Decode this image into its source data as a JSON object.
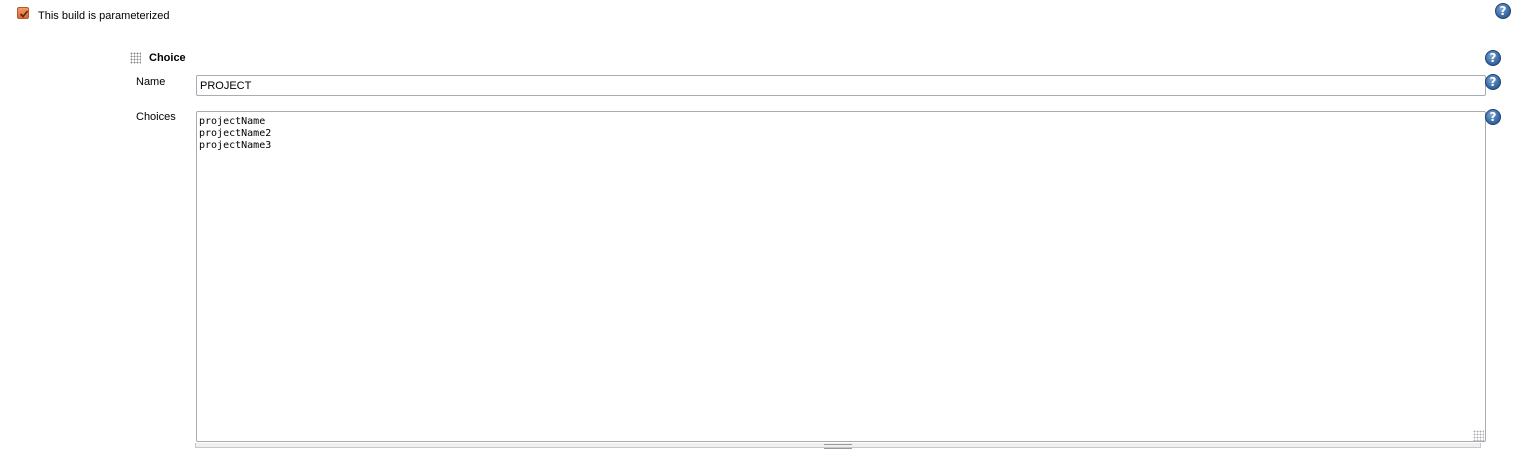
{
  "parameterized": {
    "checked": true,
    "label": "This build is parameterized"
  },
  "choice_section": {
    "title": "Choice",
    "name_field": {
      "label": "Name",
      "value": "PROJECT"
    },
    "choices_field": {
      "label": "Choices",
      "value": "projectName\nprojectName2\nprojectName3"
    }
  },
  "icons": {
    "help": "question-mark-icon",
    "drag": "drag-handle-icon"
  },
  "colors": {
    "checkbox_accent": "#dc6a36",
    "help_icon": "#3c6ea8"
  }
}
